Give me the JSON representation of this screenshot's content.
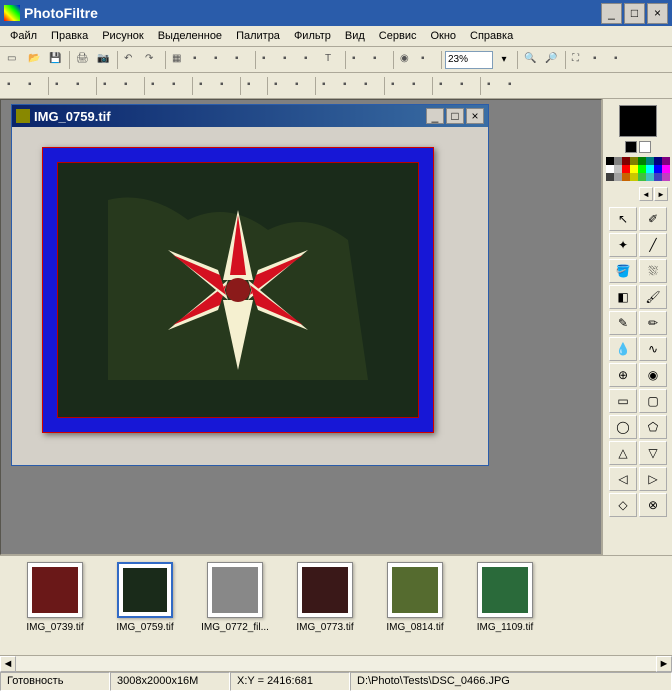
{
  "app": {
    "title": "PhotoFiltre"
  },
  "window_controls": {
    "minimize": "_",
    "maximize": "□",
    "close": "×"
  },
  "menu": [
    "Файл",
    "Правка",
    "Рисунок",
    "Выделенное",
    "Палитра",
    "Фильтр",
    "Вид",
    "Сервис",
    "Окно",
    "Справка"
  ],
  "toolbar1": {
    "icons": [
      "new",
      "open",
      "save",
      "",
      "print",
      "scan",
      "",
      "undo",
      "redo",
      "",
      "grid",
      "palette1",
      "palette2",
      "layers",
      "",
      "a-icon",
      "i-icon",
      "select",
      "text",
      "",
      "adjust",
      "swap",
      "",
      "color",
      "color2",
      "",
      "zoom",
      "",
      "zoomin",
      "zoomout",
      "",
      "full",
      "expand",
      "fit"
    ],
    "zoom": "23%"
  },
  "toolbar2": {
    "icons": [
      "auto1",
      "auto2",
      "",
      "bright-",
      "bright+",
      "",
      "contrast-",
      "contrast+",
      "",
      "gamma-",
      "gamma+",
      "",
      "sat-",
      "sat+",
      "",
      "hue",
      "",
      "sharpen",
      "blur",
      "",
      "adj1",
      "adj2",
      "adj3",
      "",
      "var1",
      "var2",
      "",
      "grad1",
      "grad2",
      "",
      "photo",
      "fx"
    ]
  },
  "child": {
    "title": "IMG_0759.tif",
    "minimize": "_",
    "maximize": "□",
    "close": "×"
  },
  "side": {
    "swatch_colors": [
      "#000",
      "#808080",
      "#800000",
      "#808000",
      "#008000",
      "#008080",
      "#000080",
      "#800080",
      "#fff",
      "#c0c0c0",
      "#f00",
      "#ff0",
      "#0f0",
      "#0ff",
      "#00f",
      "#f0f",
      "#404040",
      "#a0a0a0",
      "#c86400",
      "#c8c800",
      "#40c040",
      "#40c0c0",
      "#4040c0",
      "#c040c0"
    ],
    "tools": [
      "pointer",
      "eyedropper",
      "wand",
      "line",
      "bucket",
      "spray",
      "eraser",
      "brush",
      "pencil",
      "marker",
      "drop",
      "smudge",
      "clone",
      "stamp",
      "rect",
      "roundrect",
      "ellipse",
      "poly",
      "tri-up",
      "tri-down",
      "tri-left",
      "tri-right",
      "diamond",
      "lasso"
    ]
  },
  "thumbs": [
    {
      "label": "IMG_0739.tif",
      "bg": "#6a1818"
    },
    {
      "label": "IMG_0759.tif",
      "bg": "#1a2b1a",
      "selected": true
    },
    {
      "label": "IMG_0772_fil...",
      "bg": "#888"
    },
    {
      "label": "IMG_0773.tif",
      "bg": "#3a1818"
    },
    {
      "label": "IMG_0814.tif",
      "bg": "#556b2f"
    },
    {
      "label": "IMG_1109.tif",
      "bg": "#2a6a3a"
    }
  ],
  "status": {
    "ready": "Готовность",
    "dims": "3008x2000x16M",
    "coords": "X:Y = 2416:681",
    "path": "D:\\Photo\\Tests\\DSC_0466.JPG"
  }
}
